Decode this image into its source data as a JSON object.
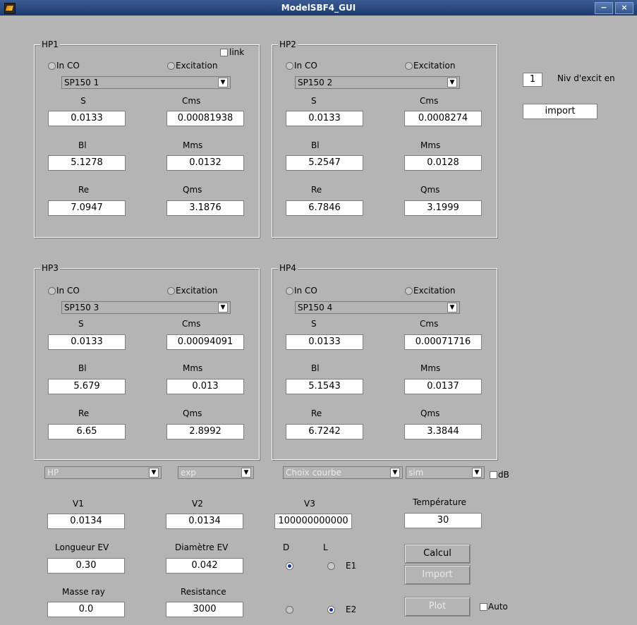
{
  "window": {
    "title": "ModelSBF4_GUI",
    "minimize": "−",
    "close": "×"
  },
  "hp": [
    {
      "title": "HP1",
      "radio_in": "In CO",
      "radio_exc": "Excitation",
      "select": "SP150 1",
      "S_label": "S",
      "S": "0.0133",
      "Cms_label": "Cms",
      "Cms": "0.00081938",
      "Bl_label": "Bl",
      "Bl": "5.1278",
      "Mms_label": "Mms",
      "Mms": "0.0132",
      "Re_label": "Re",
      "Re": "7.0947",
      "Qms_label": "Qms",
      "Qms": "3.1876"
    },
    {
      "title": "HP2",
      "radio_in": "In CO",
      "radio_exc": "Excitation",
      "select": "SP150 2",
      "S_label": "S",
      "S": "0.0133",
      "Cms_label": "Cms",
      "Cms": "0.0008274",
      "Bl_label": "Bl",
      "Bl": "5.2547",
      "Mms_label": "Mms",
      "Mms": "0.0128",
      "Re_label": "Re",
      "Re": "6.7846",
      "Qms_label": "Qms",
      "Qms": "3.1999"
    },
    {
      "title": "HP3",
      "radio_in": "In CO",
      "radio_exc": "Excitation",
      "select": "SP150 3",
      "S_label": "S",
      "S": "0.0133",
      "Cms_label": "Cms",
      "Cms": "0.00094091",
      "Bl_label": "Bl",
      "Bl": "5.679",
      "Mms_label": "Mms",
      "Mms": "0.013",
      "Re_label": "Re",
      "Re": "6.65",
      "Qms_label": "Qms",
      "Qms": "2.8992"
    },
    {
      "title": "HP4",
      "radio_in": "In CO",
      "radio_exc": "Excitation",
      "select": "SP150 4",
      "S_label": "S",
      "S": "0.0133",
      "Cms_label": "Cms",
      "Cms": "0.00071716",
      "Bl_label": "Bl",
      "Bl": "5.1543",
      "Mms_label": "Mms",
      "Mms": "0.0137",
      "Re_label": "Re",
      "Re": "6.7242",
      "Qms_label": "Qms",
      "Qms": "3.3844"
    }
  ],
  "link_label": "link",
  "niv": {
    "value": "1",
    "label": "Niv d'excit en"
  },
  "import_top": "import",
  "selects": {
    "hp": "HP",
    "exp": "exp",
    "choix": "Choix courbe",
    "sim": "sim",
    "db_label": "dB"
  },
  "params": {
    "v1_label": "V1",
    "v1": "0.0134",
    "v2_label": "V2",
    "v2": "0.0134",
    "v3_label": "V3",
    "v3": "100000000000",
    "temp_label": "Température",
    "temp": "30",
    "longueur_label": "Longueur EV",
    "longueur": "0.30",
    "diametre_label": "Diamètre EV",
    "diametre": "0.042",
    "masse_label": "Masse ray",
    "masse": "0.0",
    "resistance_label": "Resistance",
    "resistance": "3000"
  },
  "radios": {
    "d_label": "D",
    "l_label": "L",
    "e1_label": "E1",
    "e2_label": "E2"
  },
  "buttons": {
    "calcul": "Calcul",
    "import": "Import",
    "plot": "Plot",
    "auto_label": "Auto"
  }
}
